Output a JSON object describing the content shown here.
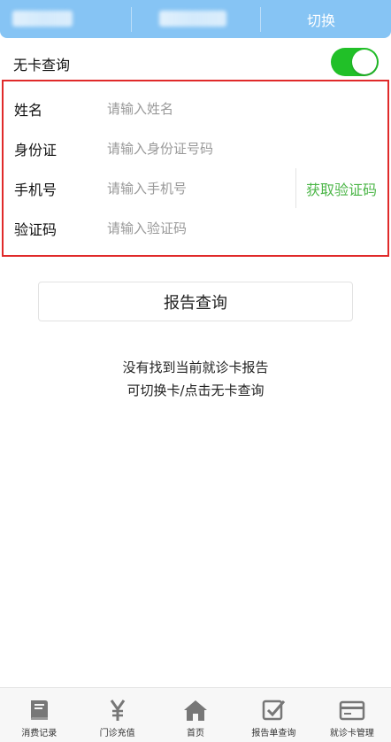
{
  "header": {
    "switch_label": "切换"
  },
  "no_card": {
    "label": "无卡查询",
    "toggle_on": true,
    "toggle_color": "#21c028"
  },
  "form": {
    "name": {
      "label": "姓名",
      "placeholder": "请输入姓名",
      "value": ""
    },
    "id_card": {
      "label": "身份证",
      "placeholder": "请输入身份证号码",
      "value": ""
    },
    "phone": {
      "label": "手机号",
      "placeholder": "请输入手机号",
      "value": ""
    },
    "get_code_label": "获取验证码",
    "code": {
      "label": "验证码",
      "placeholder": "请输入验证码",
      "value": ""
    }
  },
  "query_button_label": "报告查询",
  "message": {
    "line1": "没有找到当前就诊卡报告",
    "line2": "可切换卡/点击无卡查询"
  },
  "bottom_nav": [
    {
      "label": "消费记录",
      "icon": "book-icon"
    },
    {
      "label": "门诊充值",
      "icon": "yen-icon"
    },
    {
      "label": "首页",
      "icon": "home-icon"
    },
    {
      "label": "报告单查询",
      "icon": "checkbox-icon"
    },
    {
      "label": "就诊卡管理",
      "icon": "card-icon"
    }
  ],
  "colors": {
    "header_bg": "#86c4f4",
    "accent_green": "#4cb648",
    "highlight_border": "#e02a2a"
  }
}
